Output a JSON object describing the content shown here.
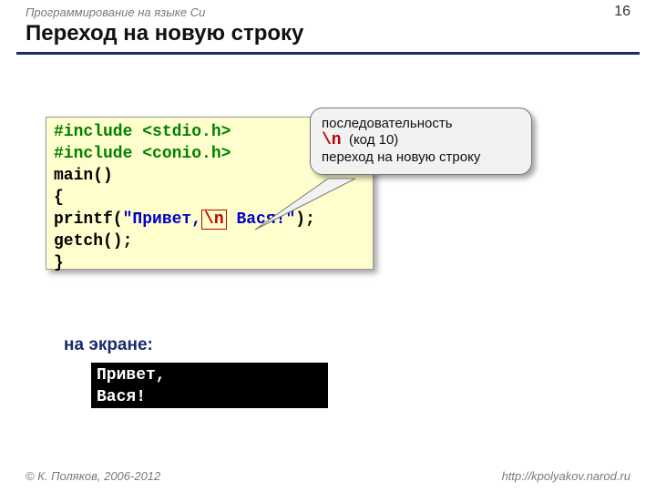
{
  "header": {
    "course": "Программирование на языке Си",
    "page_number": "16",
    "title": "Переход на новую строку"
  },
  "code": {
    "l1a": "#include ",
    "l1b": "<stdio.h>",
    "l2a": "#include ",
    "l2b": "<conio.h>",
    "l3": "main()",
    "l4": "{",
    "l5a": "printf(",
    "l5b": "\"Привет,",
    "l5c": "\\n",
    "l5d": " Вася!\"",
    "l5e": ");",
    "l6": "getch();",
    "l7": "}"
  },
  "callout": {
    "line1": "последовательность",
    "nl": "\\n",
    "code_note": "(код 10)",
    "line3": "переход на новую строку"
  },
  "screen": {
    "label": "на экране:",
    "out1": "Привет,",
    "out2": "Вася!"
  },
  "footer": {
    "left": "© К. Поляков, 2006-2012",
    "right": "http://kpolyakov.narod.ru"
  }
}
